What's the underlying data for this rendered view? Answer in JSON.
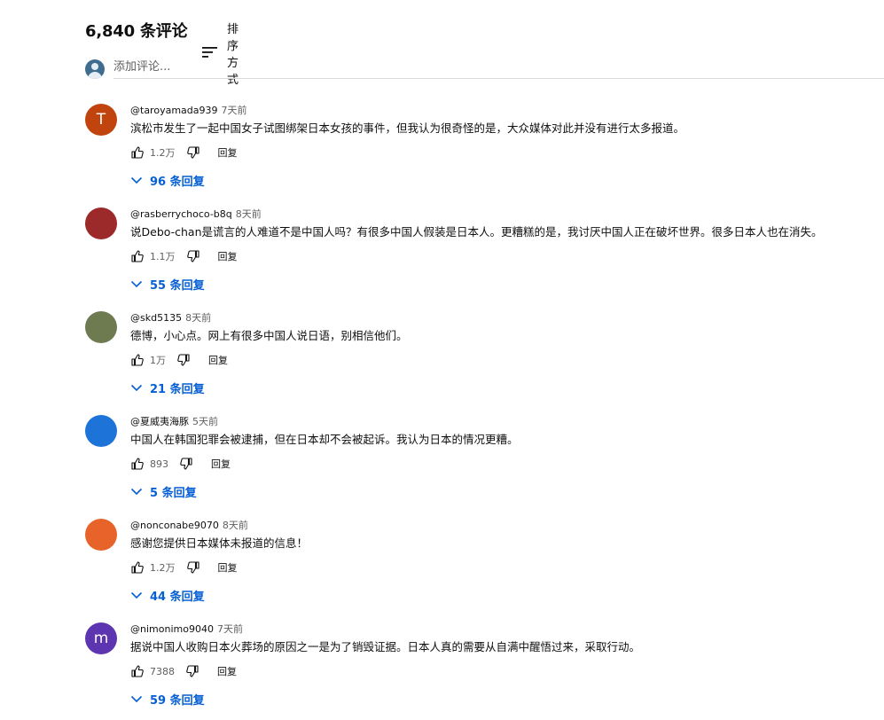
{
  "header": {
    "count_label": "6,840 条评论",
    "sort_label": "排序方式"
  },
  "add_comment": {
    "placeholder": "添加评论..."
  },
  "reply_label": "回复",
  "comments": [
    {
      "author": "@taroyamada939",
      "time": "7天前",
      "avatar_letter": "T",
      "avatar_color": "#c1440e",
      "text": "滨松市发生了一起中国女子试图绑架日本女孩的事件，但我认为很奇怪的是，大众媒体对此并没有进行太多报道。",
      "likes": "1.2万",
      "replies": "96 条回复"
    },
    {
      "author": "@rasberrychoco-b8q",
      "time": "8天前",
      "avatar_letter": "",
      "avatar_color": "#9c2a2a",
      "text": "说Debo-chan是谎言的人难道不是中国人吗？有很多中国人假装是日本人。更糟糕的是，我讨厌中国人正在破坏世界。很多日本人也在消失。",
      "likes": "1.1万",
      "replies": "55 条回复"
    },
    {
      "author": "@skd5135",
      "time": "8天前",
      "avatar_letter": "",
      "avatar_color": "#6e7a4f",
      "text": "德博，小心点。网上有很多中国人说日语，别相信他们。",
      "likes": "1万",
      "replies": "21 条回复"
    },
    {
      "author": "@夏威夷海豚",
      "time": "5天前",
      "avatar_letter": "",
      "avatar_color": "#1e73d8",
      "text": "中国人在韩国犯罪会被逮捕，但在日本却不会被起诉。我认为日本的情况更糟。",
      "likes": "893",
      "replies": "5 条回复"
    },
    {
      "author": "@nonconabe9070",
      "time": "8天前",
      "avatar_letter": "",
      "avatar_color": "#e8632a",
      "text": "感谢您提供日本媒体未报道的信息！",
      "likes": "1.2万",
      "replies": "44 条回复"
    },
    {
      "author": "@nimonimo9040",
      "time": "7天前",
      "avatar_letter": "m",
      "avatar_color": "#5e35b1",
      "text": "据说中国人收购日本火葬场的原因之一是为了销毁证据。日本人真的需要从自满中醒悟过来，采取行动。",
      "likes": "7388",
      "replies": "59 条回复"
    }
  ]
}
